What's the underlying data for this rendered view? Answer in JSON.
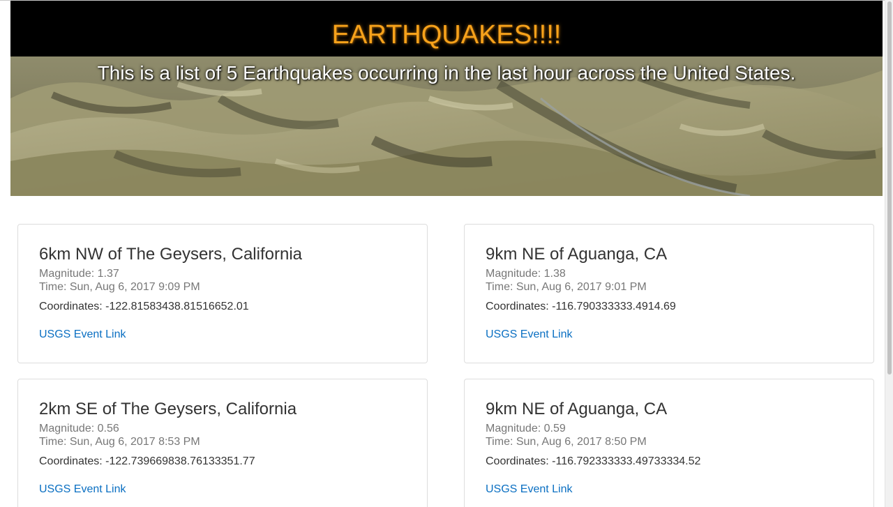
{
  "header": {
    "title": "EARTHQUAKES!!!!",
    "subtitle": "This is a list of 5 Earthquakes occurring in the last hour across the United States.",
    "title_color": "#f7a21b"
  },
  "quakes": [
    {
      "place": "6km NW of The Geysers, California",
      "magnitude": "Magnitude: 1.37",
      "time": "Time: Sun, Aug 6, 2017 9:09 PM",
      "coordinates": "Coordinates: -122.81583438.81516652.01",
      "link_label": "USGS Event Link"
    },
    {
      "place": "9km NE of Aguanga, CA",
      "magnitude": "Magnitude: 1.38",
      "time": "Time: Sun, Aug 6, 2017 9:01 PM",
      "coordinates": "Coordinates: -116.790333333.4914.69",
      "link_label": "USGS Event Link"
    },
    {
      "place": "2km SE of The Geysers, California",
      "magnitude": "Magnitude: 0.56",
      "time": "Time: Sun, Aug 6, 2017 8:53 PM",
      "coordinates": "Coordinates: -122.739669838.76133351.77",
      "link_label": "USGS Event Link"
    },
    {
      "place": "9km NE of Aguanga, CA",
      "magnitude": "Magnitude: 0.59",
      "time": "Time: Sun, Aug 6, 2017 8:50 PM",
      "coordinates": "Coordinates: -116.792333333.49733334.52",
      "link_label": "USGS Event Link"
    }
  ],
  "colors": {
    "link": "#0a6fc2",
    "muted_text": "#777777",
    "body_text": "#333333",
    "card_border": "#dddddd"
  }
}
